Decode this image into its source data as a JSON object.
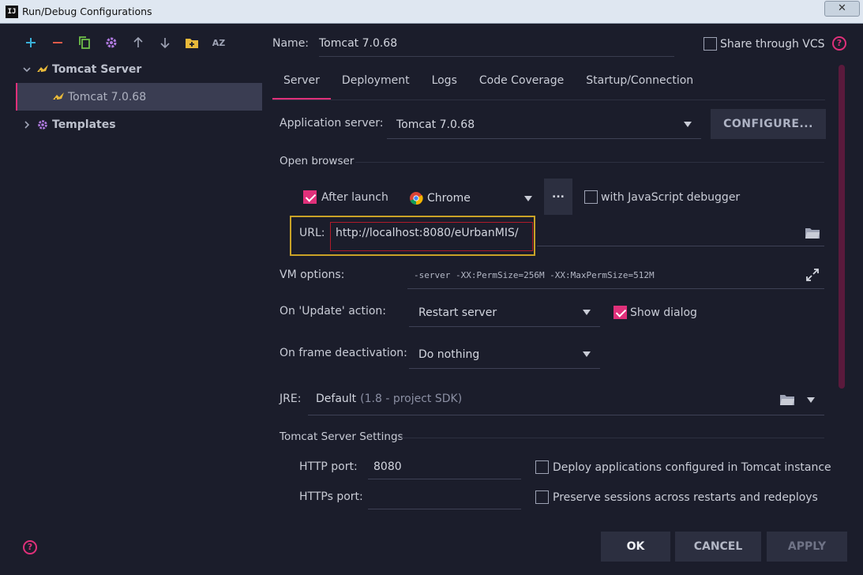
{
  "window": {
    "title": "Run/Debug Configurations",
    "app_icon": "IJ",
    "close_glyph": "✕"
  },
  "toolbar": {
    "icons": [
      "add-icon",
      "remove-icon",
      "copy-icon",
      "gear-icon",
      "arrow-up-icon",
      "arrow-down-icon",
      "folder-add-icon",
      "sort-az-icon"
    ],
    "sort_label": "AZ"
  },
  "tree": {
    "group": "Tomcat Server",
    "child": "Tomcat 7.0.68",
    "templates": "Templates"
  },
  "header": {
    "name_label": "Name:",
    "name_value": "Tomcat 7.0.68",
    "share_label": "Share through VCS",
    "help": "?"
  },
  "tabs": [
    "Server",
    "Deployment",
    "Logs",
    "Code Coverage",
    "Startup/Connection"
  ],
  "server": {
    "app_server_label": "Application server:",
    "app_server_value": "Tomcat 7.0.68",
    "configure_label": "CONFIGURE...",
    "open_browser_title": "Open browser",
    "after_launch_label": "After launch",
    "browser_value": "Chrome",
    "ellipsis": "...",
    "js_debugger_label": "with JavaScript debugger",
    "url_label": "URL:",
    "url_value": "http://localhost:8080/eUrbanMIS/",
    "vm_label": "VM options:",
    "vm_value": "-server -XX:PermSize=256M -XX:MaxPermSize=512M",
    "update_label": "On 'Update' action:",
    "update_value": "Restart server",
    "show_dialog_label": "Show dialog",
    "frame_label": "On frame deactivation:",
    "frame_value": "Do nothing",
    "jre_label": "JRE:",
    "jre_value": "Default",
    "jre_suffix": "(1.8 - project SDK)",
    "tomcat_settings_title": "Tomcat Server Settings",
    "http_label": "HTTP port:",
    "http_value": "8080",
    "https_label": "HTTPs port:",
    "https_value": "",
    "deploy_label": "Deploy applications configured in Tomcat instance",
    "preserve_label": "Preserve sessions across restarts and redeploys"
  },
  "footer": {
    "help": "?",
    "ok": "OK",
    "cancel": "CANCEL",
    "apply": "APPLY"
  },
  "colors": {
    "accent": "#e0307a",
    "background": "#1b1d2b",
    "highlight_box": "#c9a227"
  }
}
